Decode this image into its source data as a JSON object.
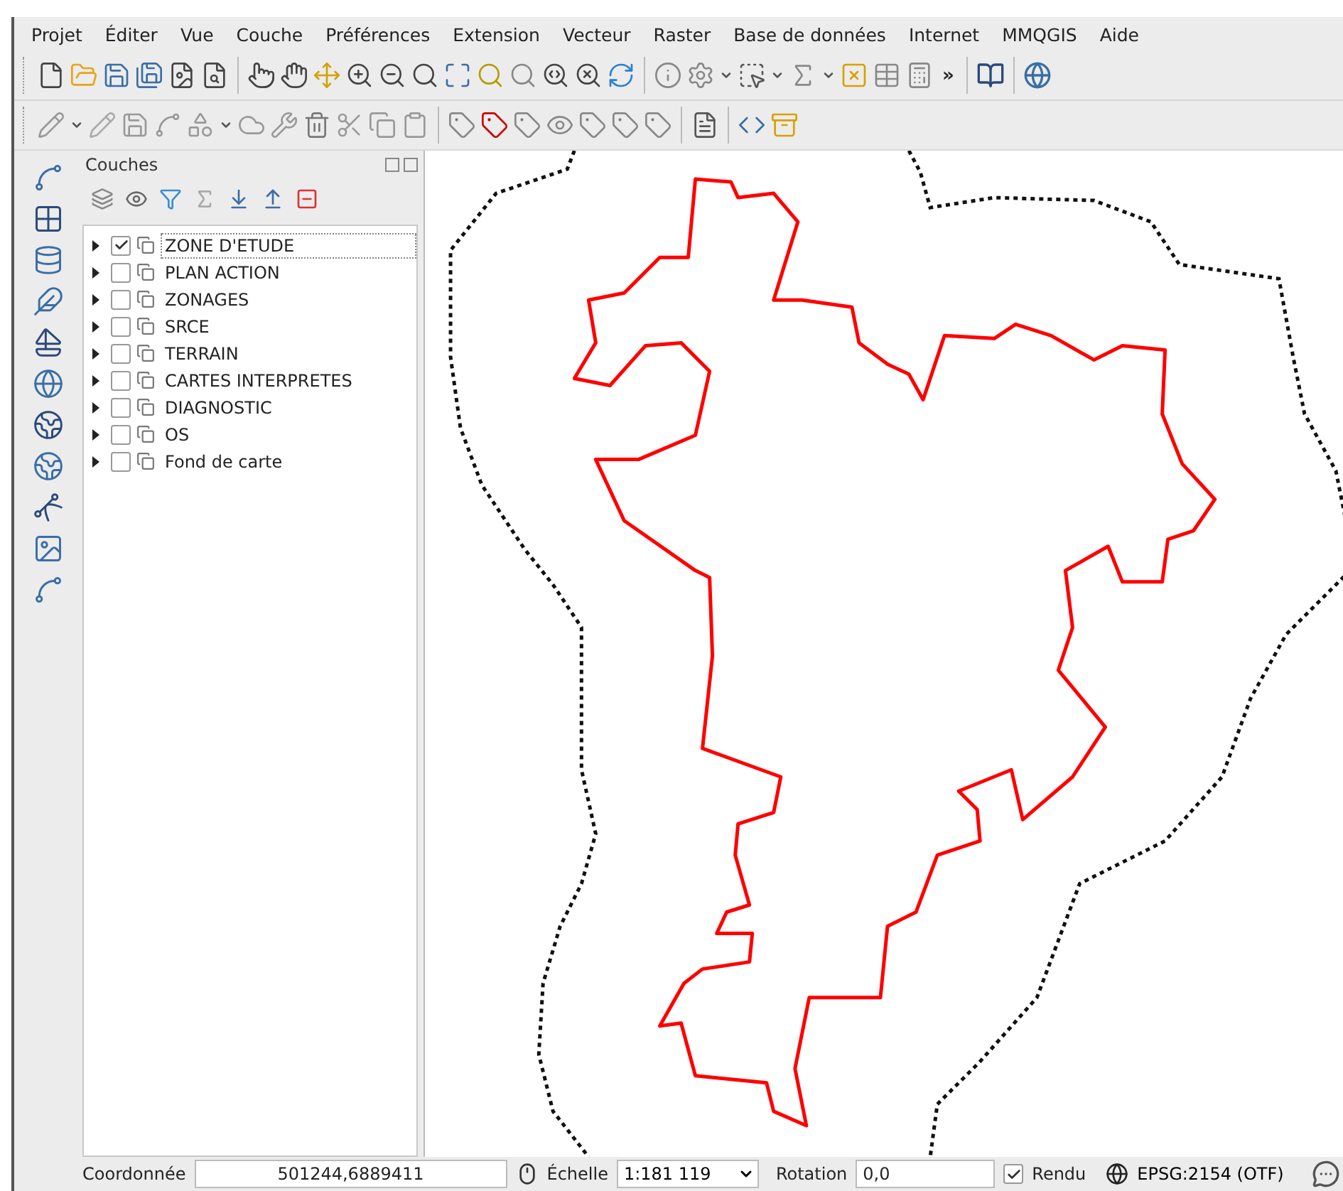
{
  "menu": [
    "Projet",
    "Éditer",
    "Vue",
    "Couche",
    "Préférences",
    "Extension",
    "Vecteur",
    "Raster",
    "Base de données",
    "Internet",
    "MMQGIS",
    "Aide"
  ],
  "toolbar": {
    "overflow": "»"
  },
  "layers_panel": {
    "title": "Couches",
    "layers": [
      {
        "name": "ZONE D'ETUDE",
        "checked": true,
        "selected": true
      },
      {
        "name": "PLAN ACTION",
        "checked": false,
        "selected": false
      },
      {
        "name": "ZONAGES",
        "checked": false,
        "selected": false
      },
      {
        "name": "SRCE",
        "checked": false,
        "selected": false
      },
      {
        "name": "TERRAIN",
        "checked": false,
        "selected": false
      },
      {
        "name": "CARTES INTERPRETES",
        "checked": false,
        "selected": false
      },
      {
        "name": "DIAGNOSTIC",
        "checked": false,
        "selected": false
      },
      {
        "name": "OS",
        "checked": false,
        "selected": false
      },
      {
        "name": "Fond de carte",
        "checked": false,
        "selected": false
      }
    ]
  },
  "status_bar": {
    "coordinate_label": "Coordonnée",
    "coordinate": "501244,6889411",
    "scale_label": "Échelle",
    "scale": "1:181 119",
    "rotation_label": "Rotation",
    "rotation": "0,0",
    "render": {
      "label": "Rendu",
      "checked": true
    },
    "crs": "EPSG:2154 (OTF)"
  }
}
